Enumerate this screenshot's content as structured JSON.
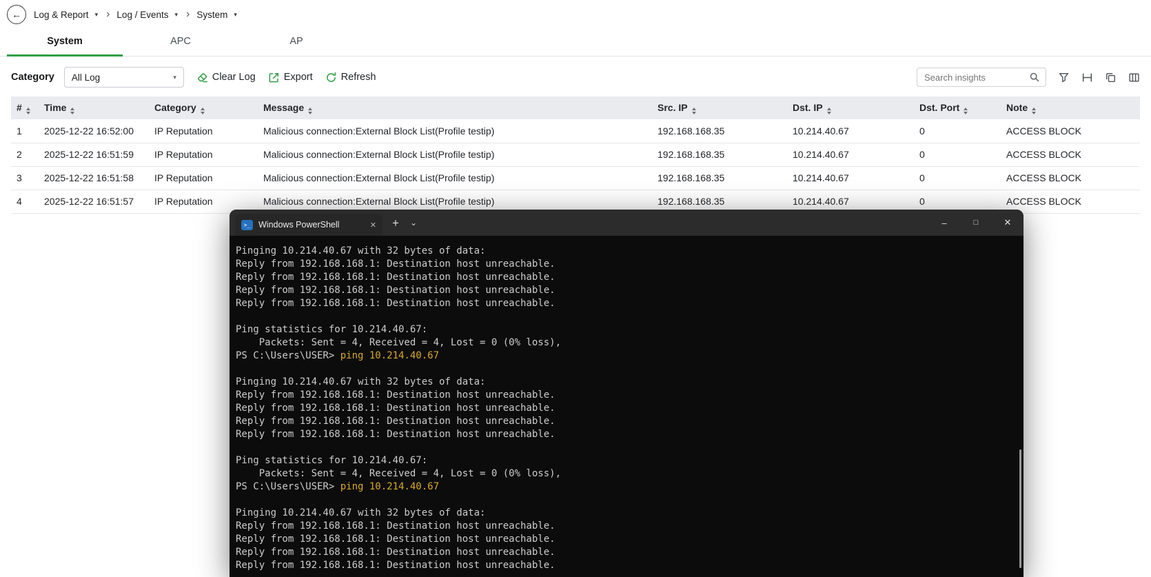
{
  "breadcrumb": {
    "items": [
      {
        "label": "Log & Report"
      },
      {
        "label": "Log / Events"
      },
      {
        "label": "System"
      }
    ]
  },
  "tabs": [
    {
      "label": "System",
      "active": true
    },
    {
      "label": "APC",
      "active": false
    },
    {
      "label": "AP",
      "active": false
    }
  ],
  "toolbar": {
    "category_label": "Category",
    "category_value": "All Log",
    "clear_log_label": "Clear Log",
    "export_label": "Export",
    "refresh_label": "Refresh",
    "search_placeholder": "Search insights"
  },
  "table": {
    "headers": [
      "#",
      "Time",
      "Category",
      "Message",
      "Src. IP",
      "Dst. IP",
      "Dst. Port",
      "Note"
    ],
    "rows": [
      [
        "1",
        "2025-12-22 16:52:00",
        "IP Reputation",
        "Malicious connection:External Block List(Profile testip)",
        "192.168.168.35",
        "10.214.40.67",
        "0",
        "ACCESS BLOCK"
      ],
      [
        "2",
        "2025-12-22 16:51:59",
        "IP Reputation",
        "Malicious connection:External Block List(Profile testip)",
        "192.168.168.35",
        "10.214.40.67",
        "0",
        "ACCESS BLOCK"
      ],
      [
        "3",
        "2025-12-22 16:51:58",
        "IP Reputation",
        "Malicious connection:External Block List(Profile testip)",
        "192.168.168.35",
        "10.214.40.67",
        "0",
        "ACCESS BLOCK"
      ],
      [
        "4",
        "2025-12-22 16:51:57",
        "IP Reputation",
        "Malicious connection:External Block List(Profile testip)",
        "192.168.168.35",
        "10.214.40.67",
        "0",
        "ACCESS BLOCK"
      ]
    ]
  },
  "terminal": {
    "title": "Windows PowerShell",
    "lines": [
      [
        {
          "t": "Pinging 10.214.40.67 with 32 bytes of data:"
        }
      ],
      [
        {
          "t": "Reply from 192.168.168.1: Destination host unreachable."
        }
      ],
      [
        {
          "t": "Reply from 192.168.168.1: Destination host unreachable."
        }
      ],
      [
        {
          "t": "Reply from 192.168.168.1: Destination host unreachable."
        }
      ],
      [
        {
          "t": "Reply from 192.168.168.1: Destination host unreachable."
        }
      ],
      [],
      [
        {
          "t": "Ping statistics for 10.214.40.67:"
        }
      ],
      [
        {
          "t": "    Packets: Sent = 4, Received = 4, Lost = 0 (0% loss),"
        }
      ],
      [
        {
          "t": "PS C:\\Users\\USER> "
        },
        {
          "t": "ping 10.214.40.67",
          "s": "cmd"
        }
      ],
      [],
      [
        {
          "t": "Pinging 10.214.40.67 with 32 bytes of data:"
        }
      ],
      [
        {
          "t": "Reply from 192.168.168.1: Destination host unreachable."
        }
      ],
      [
        {
          "t": "Reply from 192.168.168.1: Destination host unreachable."
        }
      ],
      [
        {
          "t": "Reply from 192.168.168.1: Destination host unreachable."
        }
      ],
      [
        {
          "t": "Reply from 192.168.168.1: Destination host unreachable."
        }
      ],
      [],
      [
        {
          "t": "Ping statistics for 10.214.40.67:"
        }
      ],
      [
        {
          "t": "    Packets: Sent = 4, Received = 4, Lost = 0 (0% loss),"
        }
      ],
      [
        {
          "t": "PS C:\\Users\\USER> "
        },
        {
          "t": "ping 10.214.40.67",
          "s": "cmd"
        }
      ],
      [],
      [
        {
          "t": "Pinging 10.214.40.67 with 32 bytes of data:"
        }
      ],
      [
        {
          "t": "Reply from 192.168.168.1: Destination host unreachable."
        }
      ],
      [
        {
          "t": "Reply from 192.168.168.1: Destination host unreachable."
        }
      ],
      [
        {
          "t": "Reply from 192.168.168.1: Destination host unreachable."
        }
      ],
      [
        {
          "t": "Reply from 192.168.168.1: Destination host unreachable."
        }
      ]
    ]
  },
  "icons": {
    "back": "←",
    "caret_down": "▾",
    "separator": "›",
    "tab_close": "✕",
    "new_tab": "+",
    "tab_dropdown": "⌄",
    "minimize": "–",
    "maximize": "□",
    "close": "✕",
    "ps_glyph": ">_"
  },
  "colors": {
    "accent_green": "#2f9e44",
    "table_header_bg": "#e9ebee",
    "terminal_bg": "#0c0c0c",
    "terminal_titlebar": "#2c2c2c",
    "command_yellow": "#d8a927",
    "powershell_icon_blue": "#2671be"
  }
}
